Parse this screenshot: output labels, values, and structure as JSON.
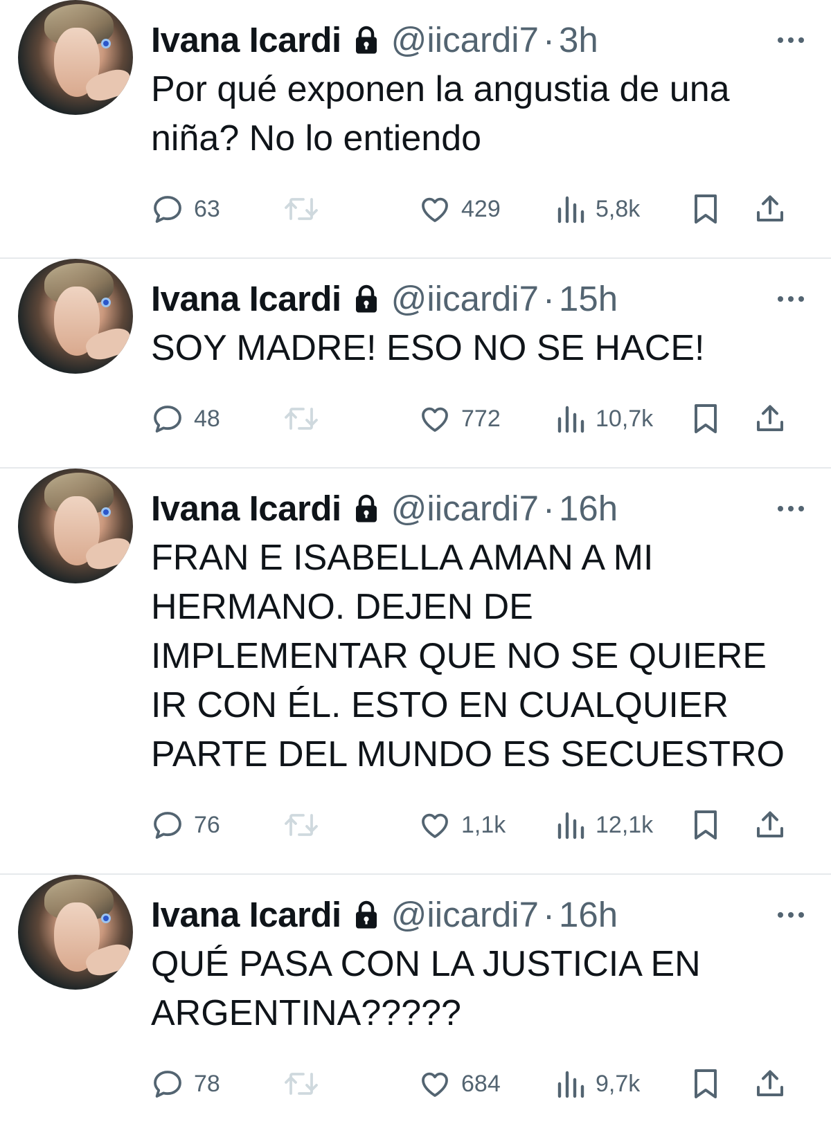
{
  "tweets": [
    {
      "author_name": "Ivana Icardi",
      "handle": "@iicardi7",
      "separator": "·",
      "time": "3h",
      "text": "Por qué exponen la angustia de una\nniña? No lo entiendo",
      "replies": "63",
      "likes": "429",
      "views": "5,8k"
    },
    {
      "author_name": "Ivana Icardi",
      "handle": "@iicardi7",
      "separator": "·",
      "time": "15h",
      "text": "SOY MADRE! ESO NO SE HACE!",
      "replies": "48",
      "likes": "772",
      "views": "10,7k"
    },
    {
      "author_name": "Ivana Icardi",
      "handle": "@iicardi7",
      "separator": "·",
      "time": "16h",
      "text": "FRAN E ISABELLA AMAN A MI\nHERMANO. DEJEN DE\nIMPLEMENTAR QUE NO SE QUIERE\nIR CON ÉL. ESTO EN CUALQUIER\nPARTE DEL MUNDO ES SECUESTRO",
      "replies": "76",
      "likes": "1,1k",
      "views": "12,1k"
    },
    {
      "author_name": "Ivana Icardi",
      "handle": "@iicardi7",
      "separator": "·",
      "time": "16h",
      "text": "QUÉ PASA CON LA JUSTICIA EN\nARGENTINA?????",
      "replies": "78",
      "likes": "684",
      "views": "9,7k"
    }
  ],
  "icons": {
    "verified_lock": "lock-icon",
    "more": "more-icon",
    "reply": "reply-icon",
    "retweet": "retweet-icon",
    "like": "heart-icon",
    "views": "views-icon",
    "bookmark": "bookmark-icon",
    "share": "share-icon"
  },
  "colors": {
    "text_primary": "#0f1419",
    "text_secondary": "#536471",
    "retweet_disabled": "#cfd9de",
    "divider": "#e6e9ec"
  }
}
